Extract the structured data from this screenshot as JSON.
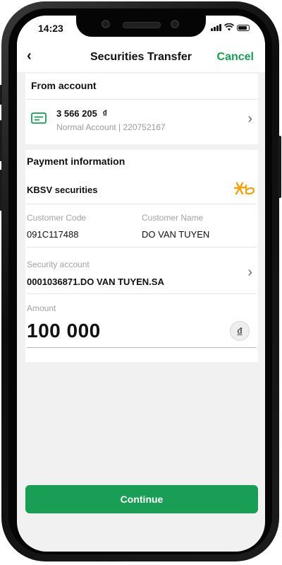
{
  "status_bar": {
    "time": "14:23"
  },
  "header": {
    "back_label": "‹",
    "title": "Securities Transfer",
    "cancel_label": "Cancel"
  },
  "from_account": {
    "section_label": "From account",
    "balance": "3 566 205",
    "currency_symbol": "₫",
    "subtitle": "Normal Account | 220752167"
  },
  "payment": {
    "section_label": "Payment information",
    "provider_name": "KBSV securities",
    "customer_code_label": "Customer Code",
    "customer_code": "091C117488",
    "customer_name_label": "Customer Name",
    "customer_name": "DO VAN TUYEN",
    "security_account_label": "Security account",
    "security_account": "0001036871.DO VAN TUYEN.SA",
    "amount_label": "Amount",
    "amount": "100 000",
    "currency_button": "đ"
  },
  "actions": {
    "continue_label": "Continue"
  },
  "colors": {
    "accent": "#1a9d55",
    "background": "#f1f1f1",
    "logo": "#f2a20c"
  },
  "icons": [
    "card-icon",
    "chevron-right-icon",
    "kbsv-logo",
    "wifi-icon",
    "battery-icon",
    "signal-icon"
  ]
}
